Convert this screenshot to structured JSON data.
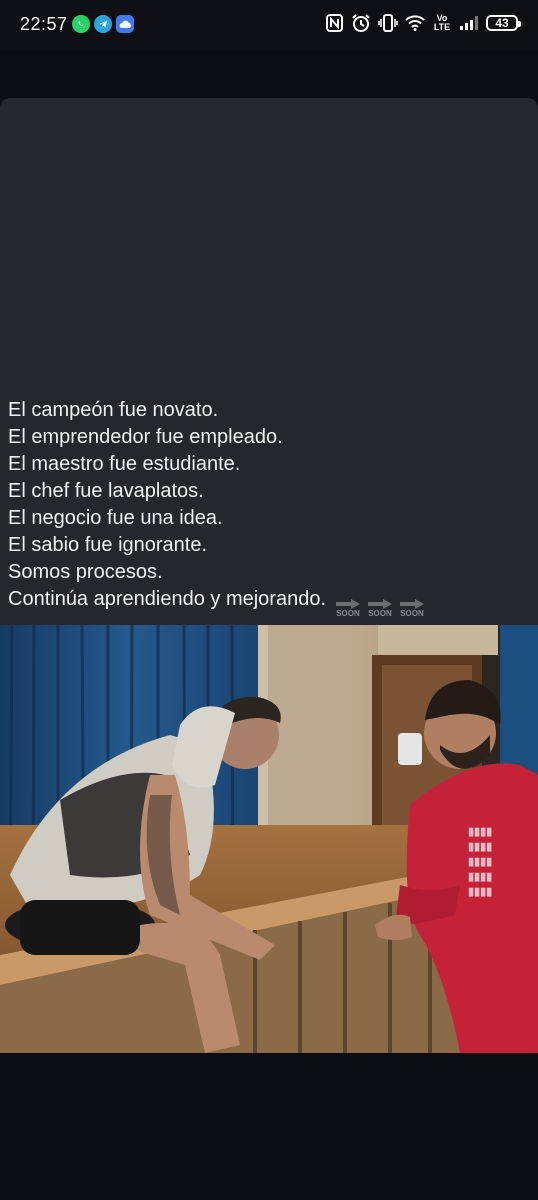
{
  "status_bar": {
    "time": "22:57",
    "notification_icons": [
      "whatsapp-icon",
      "telegram-icon",
      "cloud-icon"
    ],
    "indicator_icons": [
      "nfc-icon",
      "alarm-icon",
      "vibrate-icon",
      "wifi-icon",
      "volte-icon",
      "signal-icon"
    ],
    "volte_top": "Vo",
    "volte_bottom": "LTE",
    "battery_level": "43"
  },
  "post": {
    "lines": [
      "El campeón fue novato.",
      "El emprendedor fue empleado.",
      "El maestro fue estudiante.",
      "El chef fue lavaplatos.",
      "El negocio fue una idea.",
      "El sabio fue ignorante.",
      "Somos procesos.",
      "Continúa aprendiendo y mejorando."
    ],
    "watermark": [
      "SOON",
      "SOON",
      "SOON"
    ]
  },
  "photo": {
    "description_icon": "photo-image"
  },
  "colors": {
    "card_bg": "#26272b",
    "page_bg": "#0b0d10",
    "curtain": "#1f4d7a",
    "sweatshirt": "#c5223a"
  }
}
